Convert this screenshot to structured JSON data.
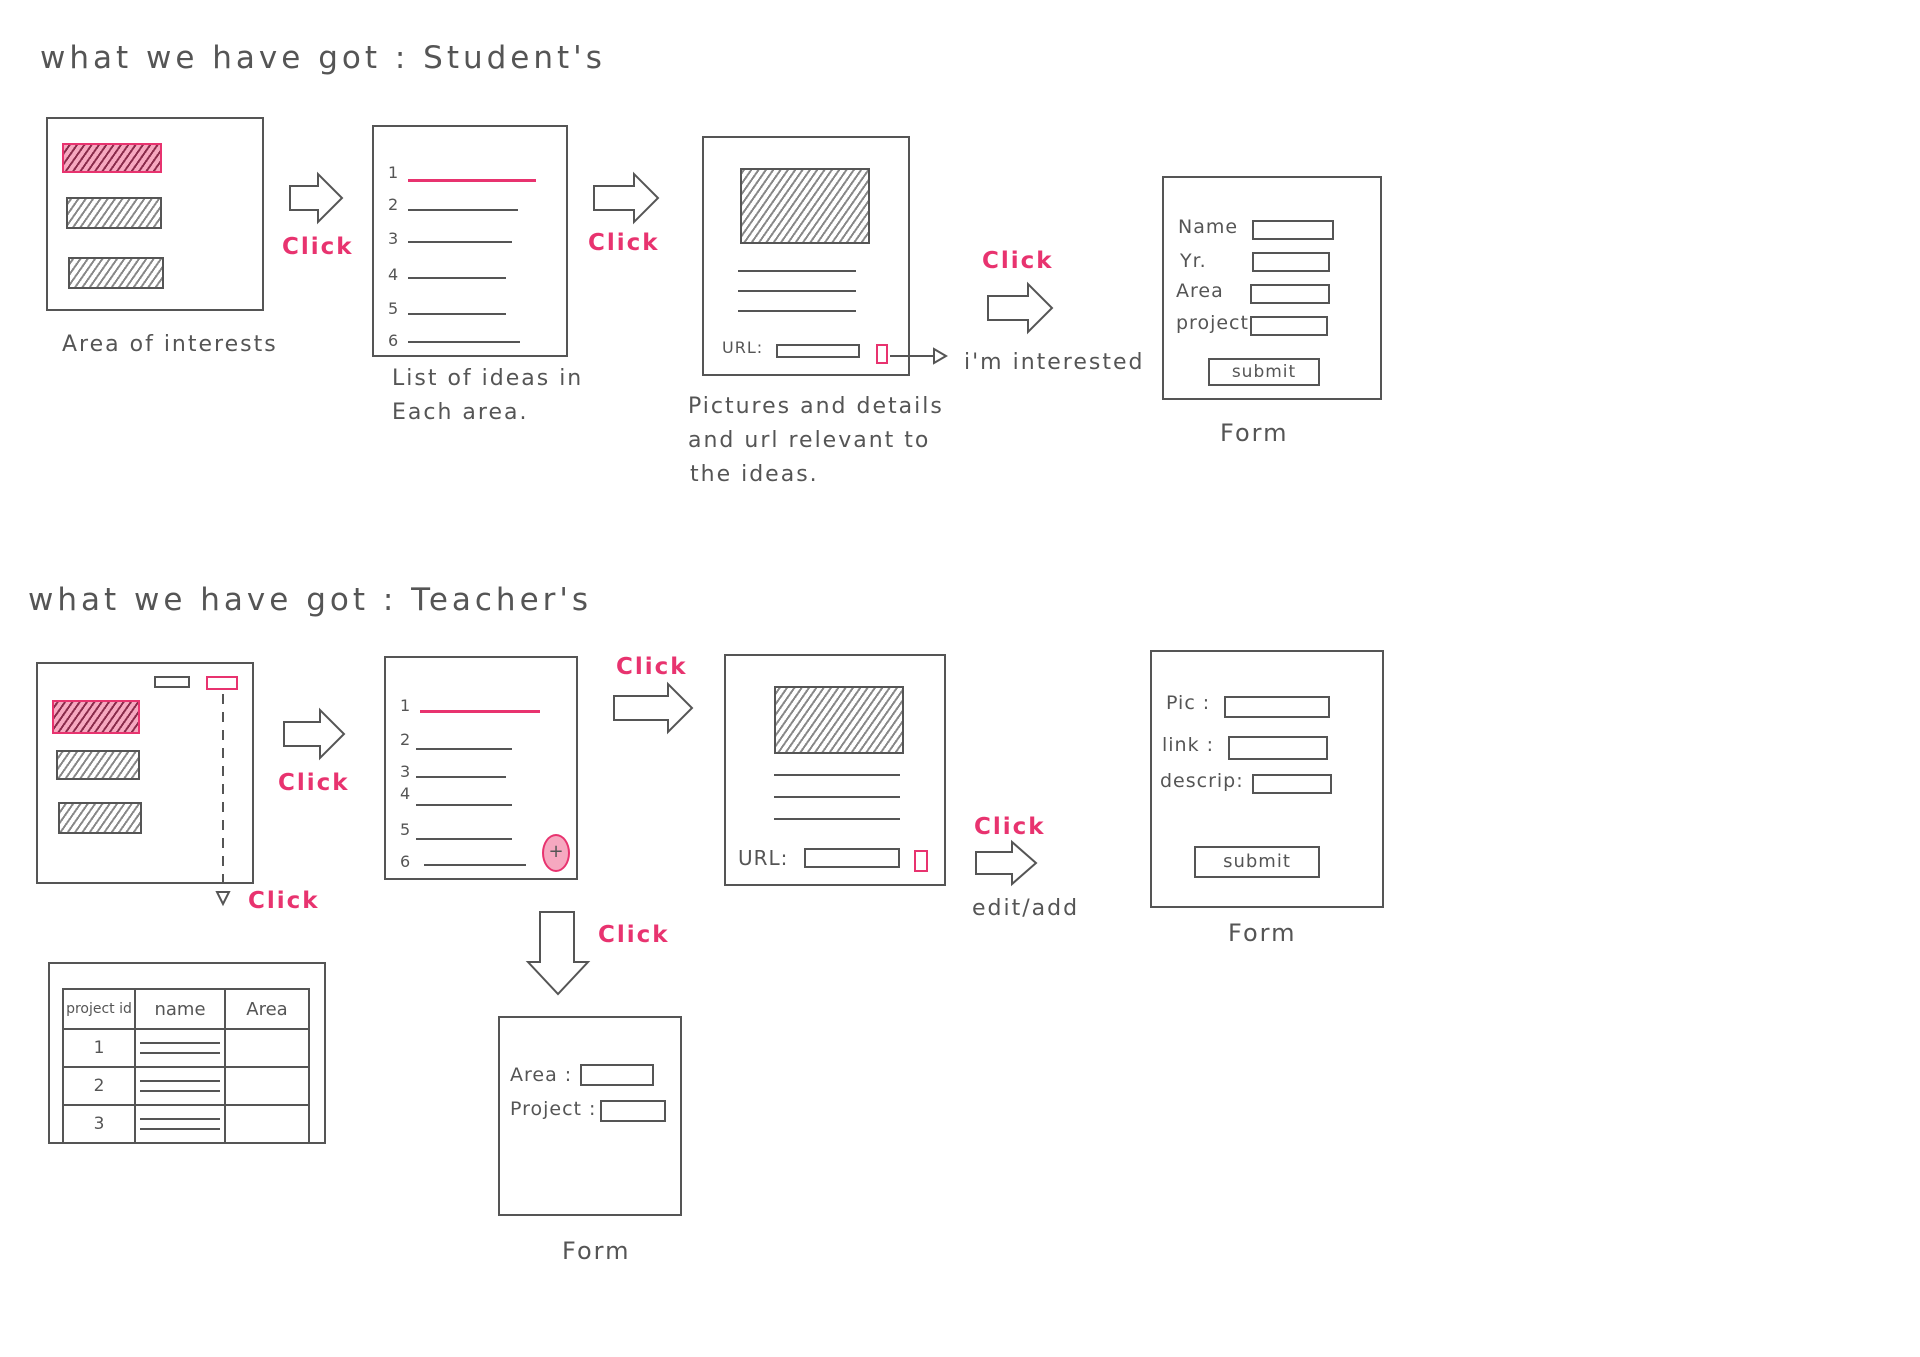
{
  "student": {
    "heading": "what we have got : Student's",
    "area_caption": "Area of interests",
    "list_caption": [
      "List of ideas in",
      "Each area."
    ],
    "list_numbers": [
      "1",
      "2",
      "3",
      "4",
      "5",
      "6"
    ],
    "details_caption": [
      "Pictures and details",
      "and url relevant to",
      "the ideas."
    ],
    "url_label": "URL:",
    "interested_label": "i'm interested",
    "form_fields": [
      "Name",
      "Yr.",
      "Area",
      "project"
    ],
    "submit_label": "submit",
    "form_caption": "Form"
  },
  "teacher": {
    "heading": "what we have got : Teacher's",
    "list_numbers": [
      "1",
      "2",
      "3",
      "4",
      "5",
      "6"
    ],
    "add_icon_glyph": "+",
    "url_label": "URL:",
    "edit_label": "edit/add",
    "form_fields": [
      "Pic :",
      "link :",
      "descrip:"
    ],
    "submit_label": "submit",
    "form_caption": "Form",
    "add_form_fields": [
      "Area :",
      "Project :"
    ],
    "add_form_caption": "Form",
    "table": {
      "headers": [
        "project id",
        "name",
        "Area"
      ],
      "rows": [
        "1",
        "2",
        "3"
      ]
    }
  },
  "click_label": "Click",
  "colors": {
    "accent": "#e8336f",
    "ink": "#555555"
  }
}
